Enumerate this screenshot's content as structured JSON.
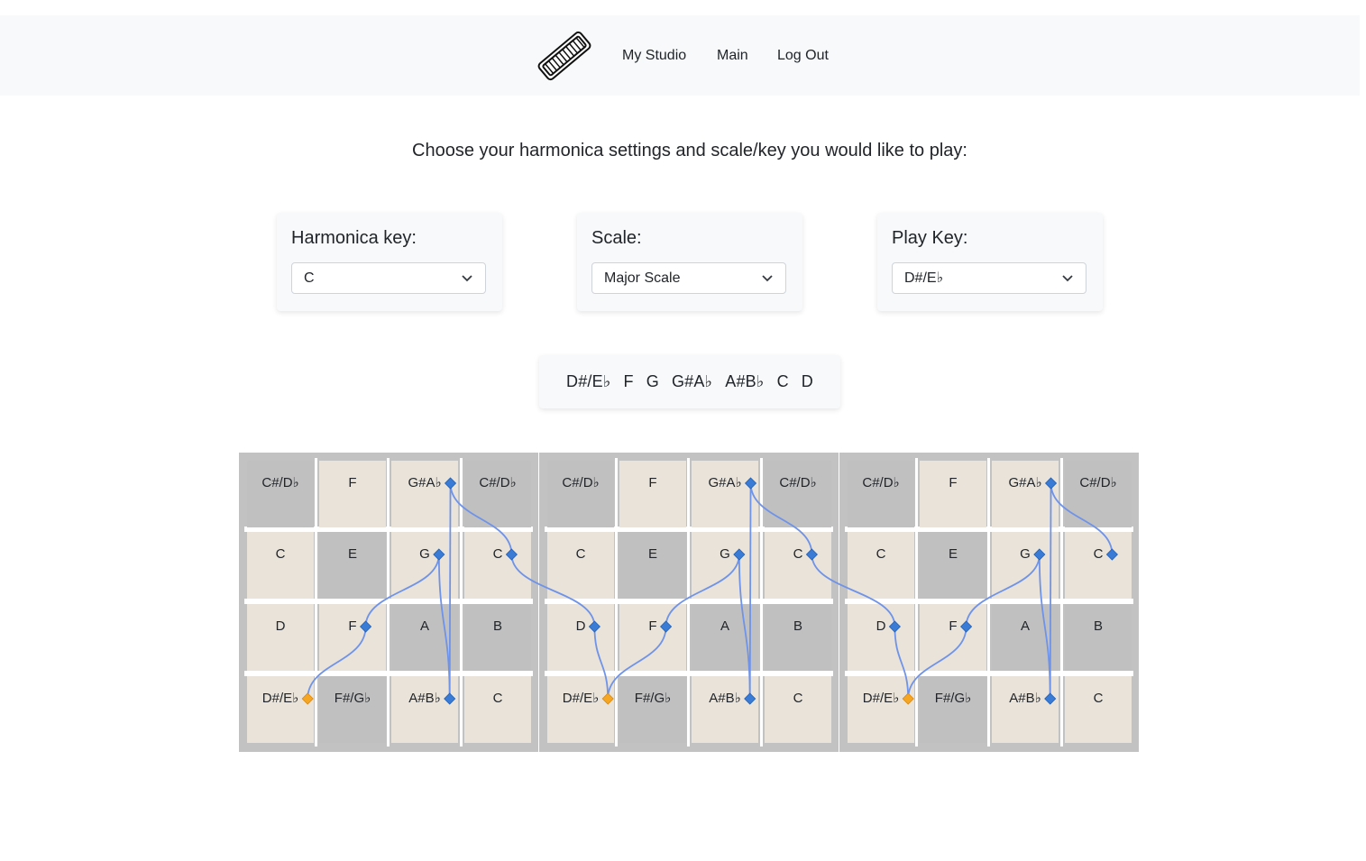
{
  "nav": {
    "logo_icon": "harmonica-icon",
    "links": [
      "My Studio",
      "Main",
      "Log Out"
    ]
  },
  "prompt": "Choose your harmonica settings and scale/key you would like to play:",
  "controls": {
    "harmonica_key": {
      "label": "Harmonica key:",
      "value": "C"
    },
    "scale": {
      "label": "Scale:",
      "value": "Major Scale"
    },
    "play_key": {
      "label": "Play Key:",
      "value": "D#/E♭"
    }
  },
  "scale_notes": [
    "D#/E♭",
    "F",
    "G",
    "G#A♭",
    "A#B♭",
    "C",
    "D"
  ],
  "colors": {
    "dark_cell": "#c0c0c0",
    "light_cell": "#e9e3da",
    "path_line": "#6f93e8",
    "scale_marker": "#3a7bd5",
    "root_marker": "#f5a623"
  },
  "harmonica_panels": [
    {
      "rows": [
        [
          "C#/D♭",
          "F",
          "G#A♭",
          "C#/D♭"
        ],
        [
          "C",
          "E",
          "G",
          "C"
        ],
        [
          "D",
          "F",
          "A",
          "B"
        ],
        [
          "D#/E♭",
          "F#/G♭",
          "A#B♭",
          "C"
        ]
      ]
    },
    {
      "rows": [
        [
          "C#/D♭",
          "F",
          "G#A♭",
          "C#/D♭"
        ],
        [
          "C",
          "E",
          "G",
          "C"
        ],
        [
          "D",
          "F",
          "A",
          "B"
        ],
        [
          "D#/E♭",
          "F#/G♭",
          "A#B♭",
          "C"
        ]
      ]
    },
    {
      "rows": [
        [
          "C#/D♭",
          "F",
          "G#A♭",
          "C#/D♭"
        ],
        [
          "C",
          "E",
          "G",
          "C"
        ],
        [
          "D",
          "F",
          "A",
          "B"
        ],
        [
          "D#/E♭",
          "F#/G♭",
          "A#B♭",
          "C"
        ]
      ]
    }
  ],
  "cell_shading": [
    [
      "dark",
      "light",
      "light",
      "dark"
    ],
    [
      "light",
      "dark",
      "light",
      "light"
    ],
    [
      "light",
      "light",
      "dark",
      "dark"
    ],
    [
      "light",
      "dark",
      "light",
      "light"
    ]
  ],
  "markers": [
    [
      [
        0,
        2,
        "scale"
      ],
      [
        1,
        2,
        "scale"
      ],
      [
        1,
        3,
        "scale"
      ],
      [
        2,
        1,
        "scale"
      ],
      [
        3,
        0,
        "root"
      ],
      [
        3,
        2,
        "scale"
      ]
    ],
    [
      [
        0,
        2,
        "scale"
      ],
      [
        1,
        2,
        "scale"
      ],
      [
        1,
        3,
        "scale"
      ],
      [
        2,
        0,
        "scale"
      ],
      [
        2,
        1,
        "scale"
      ],
      [
        3,
        0,
        "root"
      ],
      [
        3,
        2,
        "scale"
      ]
    ],
    [
      [
        0,
        2,
        "scale"
      ],
      [
        1,
        2,
        "scale"
      ],
      [
        1,
        3,
        "scale"
      ],
      [
        2,
        0,
        "scale"
      ],
      [
        2,
        1,
        "scale"
      ],
      [
        3,
        0,
        "root"
      ],
      [
        3,
        2,
        "scale"
      ]
    ]
  ],
  "path_sequence": [
    [
      0,
      3,
      0
    ],
    [
      0,
      2,
      1
    ],
    [
      0,
      1,
      2
    ],
    [
      0,
      3,
      2
    ],
    [
      0,
      0,
      2
    ],
    [
      0,
      1,
      3
    ],
    [
      1,
      2,
      0
    ],
    [
      1,
      3,
      0
    ],
    [
      1,
      2,
      1
    ],
    [
      1,
      1,
      2
    ],
    [
      1,
      3,
      2
    ],
    [
      1,
      0,
      2
    ],
    [
      1,
      1,
      3
    ],
    [
      2,
      2,
      0
    ],
    [
      2,
      3,
      0
    ],
    [
      2,
      2,
      1
    ],
    [
      2,
      1,
      2
    ],
    [
      2,
      3,
      2
    ],
    [
      2,
      0,
      2
    ],
    [
      2,
      1,
      3
    ]
  ]
}
